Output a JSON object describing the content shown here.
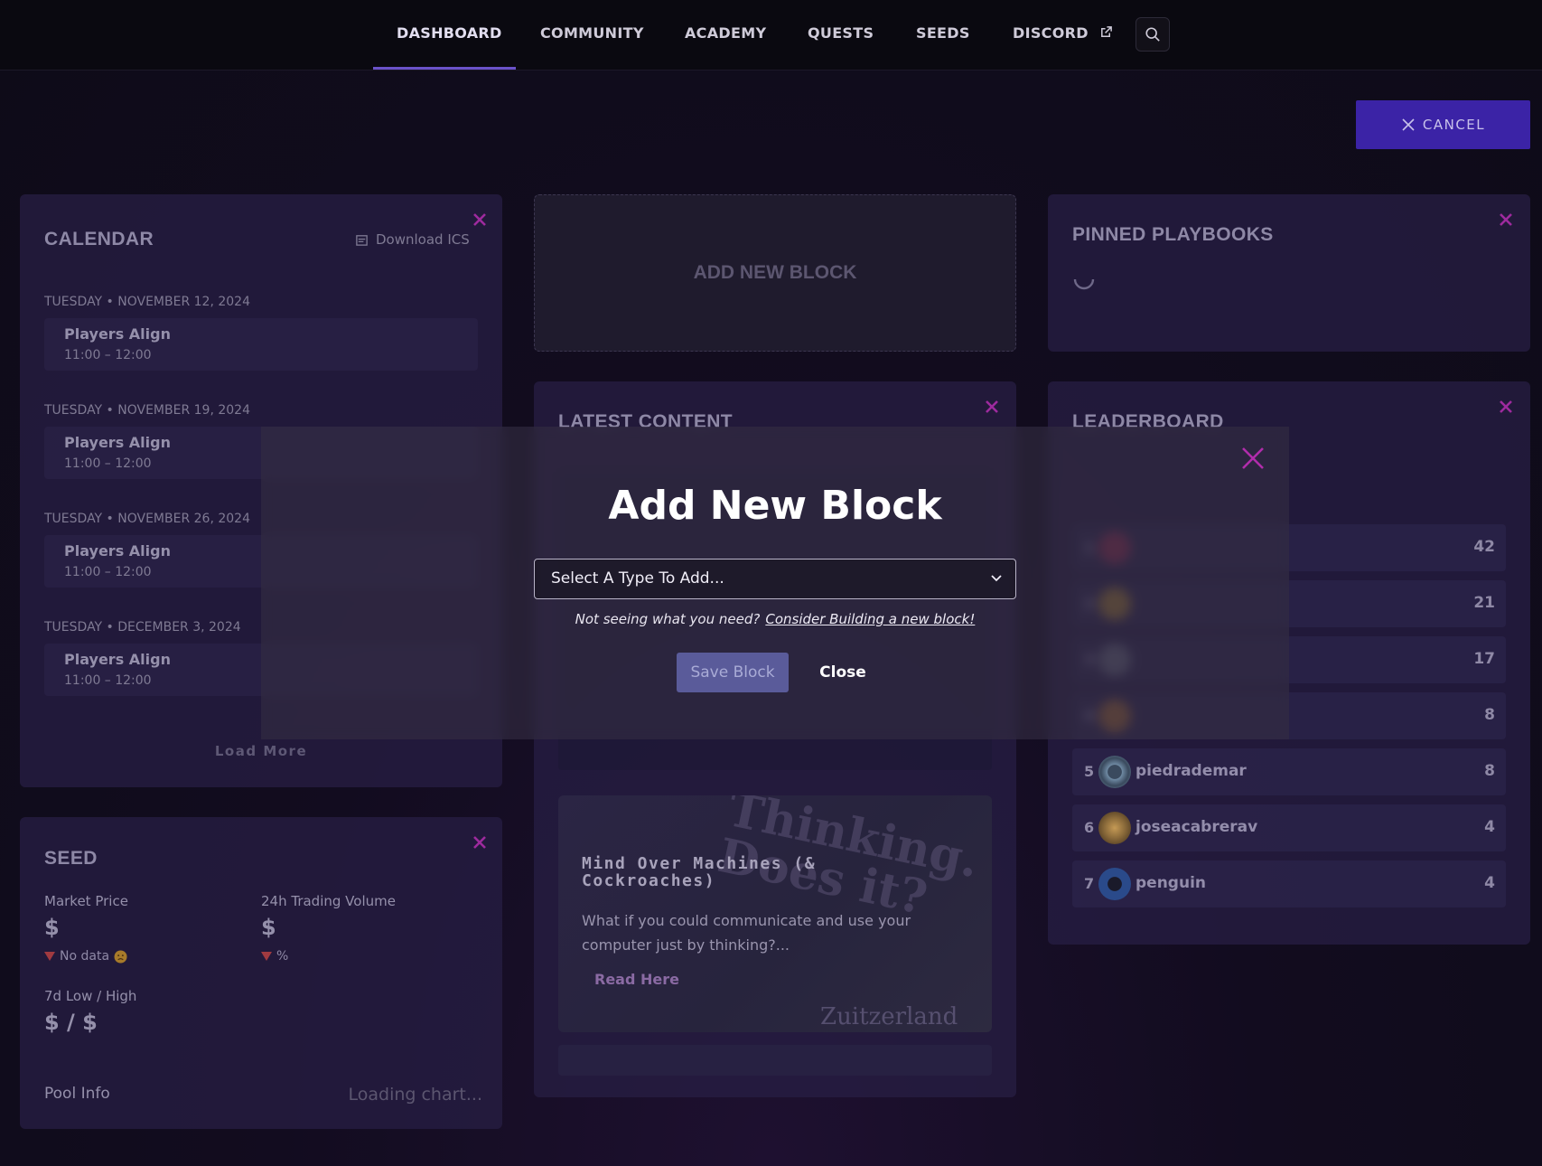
{
  "nav": {
    "items": [
      {
        "label": "DASHBOARD"
      },
      {
        "label": "COMMUNITY"
      },
      {
        "label": "ACADEMY"
      },
      {
        "label": "QUESTS"
      },
      {
        "label": "SEEDS"
      },
      {
        "label": "DISCORD"
      }
    ]
  },
  "actions": {
    "cancel_label": "CANCEL"
  },
  "calendar": {
    "title": "CALENDAR",
    "download_label": "Download ICS",
    "load_more_label": "Load More",
    "events": [
      {
        "date": "TUESDAY • NOVEMBER 12, 2024",
        "title": "Players Align",
        "time": "11:00 – 12:00"
      },
      {
        "date": "TUESDAY • NOVEMBER 19, 2024",
        "title": "Players Align",
        "time": "11:00 – 12:00"
      },
      {
        "date": "TUESDAY • NOVEMBER 26, 2024",
        "title": "Players Align",
        "time": "11:00 – 12:00"
      },
      {
        "date": "TUESDAY • DECEMBER 3, 2024",
        "title": "Players Align",
        "time": "11:00 – 12:00"
      }
    ]
  },
  "add_block": {
    "label": "ADD NEW BLOCK"
  },
  "pinned": {
    "title": "PINNED PLAYBOOKS"
  },
  "latest": {
    "title": "LATEST CONTENT",
    "article_title": "Mind Over Machines (& Cockroaches)",
    "article_desc": "What if you could communicate and use your computer just by thinking?...",
    "read_label": "Read Here",
    "image_caption": "Thinking. Does it?",
    "image_brand": "Zuitzerland"
  },
  "leaderboard": {
    "title": "LEADERBOARD",
    "rows": [
      {
        "rank": "1",
        "name": "",
        "score": "42",
        "color": "#7a2848"
      },
      {
        "rank": "2",
        "name": "",
        "score": "21",
        "color": "#8a6a30"
      },
      {
        "rank": "3",
        "name": "",
        "score": "17",
        "color": "#5a5a70"
      },
      {
        "rank": "4",
        "name": "",
        "score": "8",
        "color": "#8a5a30"
      },
      {
        "rank": "5",
        "name": "piedrademar",
        "score": "8",
        "color": "#6f8aa3"
      },
      {
        "rank": "6",
        "name": "joseacabrerav",
        "score": "4",
        "color": "#8a6a3a"
      },
      {
        "rank": "7",
        "name": "penguin",
        "score": "4",
        "color": "#2a4a8a"
      }
    ]
  },
  "seed": {
    "title": "SEED",
    "market_price_label": "Market Price",
    "market_price_value": "$",
    "no_data_label": "No data",
    "volume_label": "24h Trading Volume",
    "volume_value": "$",
    "volume_pct": "%",
    "range_label": "7d Low / High",
    "range_value": "$ / $",
    "pool_label": "Pool Info",
    "chart_loading": "Loading chart..."
  },
  "modal": {
    "title": "Add New Block",
    "select_placeholder": "Select A Type To Add...",
    "hint_text": "Not seeing what you need?",
    "hint_link": "Consider Building a new block!",
    "save_label": "Save Block",
    "close_label": "Close"
  },
  "colors": {
    "accent": "#3b23a6",
    "close_x": "#b12dab",
    "nav_underline": "#6a52c9"
  }
}
